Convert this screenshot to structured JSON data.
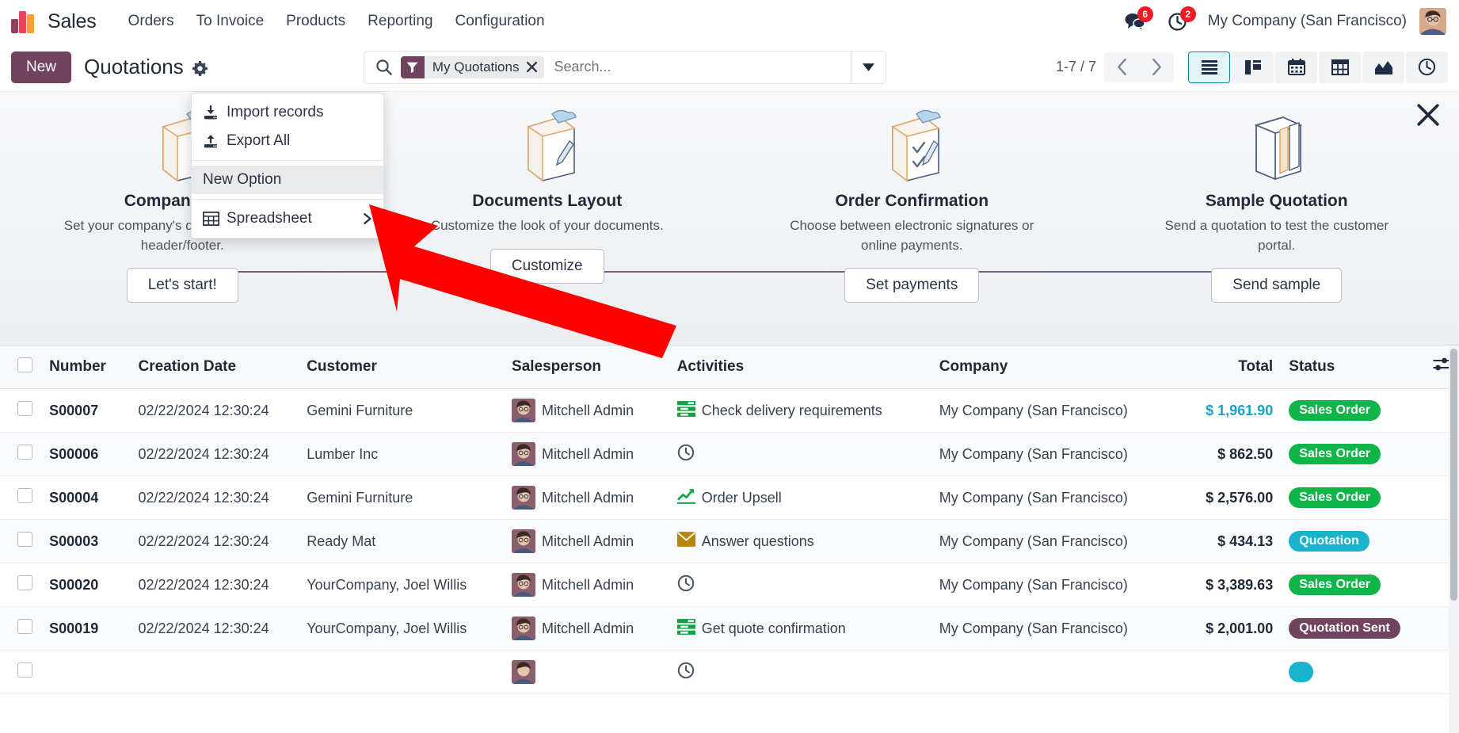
{
  "navbar": {
    "brand": "Sales",
    "menus": [
      "Orders",
      "To Invoice",
      "Products",
      "Reporting",
      "Configuration"
    ],
    "messages_badge": "6",
    "activities_badge": "2",
    "company": "My Company (San Francisco)",
    "icons": {
      "messages": "chat-bubble-icon",
      "activities": "clock-icon",
      "avatar": "user-avatar"
    }
  },
  "control_panel": {
    "new_label": "New",
    "title": "Quotations",
    "cog": "gear-icon",
    "search": {
      "facet_label": "My Quotations",
      "facet_icon": "filter-icon",
      "placeholder": "Search...",
      "value": ""
    },
    "pager": "1-7 / 7",
    "views": [
      {
        "name": "list",
        "active": true
      },
      {
        "name": "kanban",
        "active": false
      },
      {
        "name": "calendar",
        "active": false
      },
      {
        "name": "pivot",
        "active": false
      },
      {
        "name": "graph",
        "active": false
      },
      {
        "name": "activity",
        "active": false
      }
    ]
  },
  "dropdown": {
    "items": [
      {
        "label": "Import records",
        "icon": "import-icon",
        "highlighted": false,
        "separator_after": false
      },
      {
        "label": "Export All",
        "icon": "export-icon",
        "highlighted": false,
        "separator_after": true
      },
      {
        "label": "New Option",
        "icon": "",
        "highlighted": true,
        "separator_after": true
      },
      {
        "label": "Spreadsheet",
        "icon": "grid-icon",
        "highlighted": false,
        "submenu": true
      }
    ]
  },
  "onboarding": {
    "close_icon": "close-icon",
    "steps": [
      {
        "title": "Company Data",
        "desc": "Set your company's data for documents header/footer.",
        "button": "Let's start!",
        "art": "document-dollar-icon"
      },
      {
        "title": "Documents Layout",
        "desc": "Customize the look of your documents.",
        "button": "Customize",
        "art": "document-pencil-icon"
      },
      {
        "title": "Order Confirmation",
        "desc": "Choose between electronic signatures or online payments.",
        "button": "Set payments",
        "art": "document-check-icon"
      },
      {
        "title": "Sample Quotation",
        "desc": "Send a quotation to test the customer portal.",
        "button": "Send sample",
        "art": "folder-icon"
      }
    ]
  },
  "table": {
    "columns": [
      "Number",
      "Creation Date",
      "Customer",
      "Salesperson",
      "Activities",
      "Company",
      "Total",
      "Status"
    ],
    "optional_columns_icon": "settings-sliders-icon",
    "rows": [
      {
        "number": "S00007",
        "creation_date": "02/22/2024 12:30:24",
        "customer": "Gemini Furniture",
        "salesperson": "Mitchell Admin",
        "activity": "Check delivery requirements",
        "activity_icon": "green-list-icon",
        "company": "My Company (San Francisco)",
        "total": "$ 1,961.90",
        "total_teal": true,
        "status": "Sales Order",
        "status_color": "green"
      },
      {
        "number": "S00006",
        "creation_date": "02/22/2024 12:30:24",
        "customer": "Lumber Inc",
        "salesperson": "Mitchell Admin",
        "activity": "",
        "activity_icon": "clock-icon",
        "company": "My Company (San Francisco)",
        "total": "$ 862.50",
        "total_teal": false,
        "status": "Sales Order",
        "status_color": "green"
      },
      {
        "number": "S00004",
        "creation_date": "02/22/2024 12:30:24",
        "customer": "Gemini Furniture",
        "salesperson": "Mitchell Admin",
        "activity": "Order Upsell",
        "activity_icon": "green-chart-icon",
        "company": "My Company (San Francisco)",
        "total": "$ 2,576.00",
        "total_teal": false,
        "status": "Sales Order",
        "status_color": "green"
      },
      {
        "number": "S00003",
        "creation_date": "02/22/2024 12:30:24",
        "customer": "Ready Mat",
        "salesperson": "Mitchell Admin",
        "activity": "Answer questions",
        "activity_icon": "envelope-icon",
        "company": "My Company (San Francisco)",
        "total": "$ 434.13",
        "total_teal": false,
        "status": "Quotation",
        "status_color": "cyan"
      },
      {
        "number": "S00020",
        "creation_date": "02/22/2024 12:30:24",
        "customer": "YourCompany, Joel Willis",
        "salesperson": "Mitchell Admin",
        "activity": "",
        "activity_icon": "clock-icon",
        "company": "My Company (San Francisco)",
        "total": "$ 3,389.63",
        "total_teal": false,
        "status": "Sales Order",
        "status_color": "green"
      },
      {
        "number": "S00019",
        "creation_date": "02/22/2024 12:30:24",
        "customer": "YourCompany, Joel Willis",
        "salesperson": "Mitchell Admin",
        "activity": "Get quote confirmation",
        "activity_icon": "green-list-icon",
        "company": "My Company (San Francisco)",
        "total": "$ 2,001.00",
        "total_teal": false,
        "status": "Quotation Sent",
        "status_color": "plum"
      }
    ]
  },
  "colors": {
    "brand_plum": "#71435f",
    "badge_red": "#ec1c24",
    "status_green": "#0fb548",
    "status_cyan": "#19b3ce",
    "status_plum": "#71435f",
    "active_view": "#10808c",
    "annotation_arrow": "#ff0000"
  }
}
